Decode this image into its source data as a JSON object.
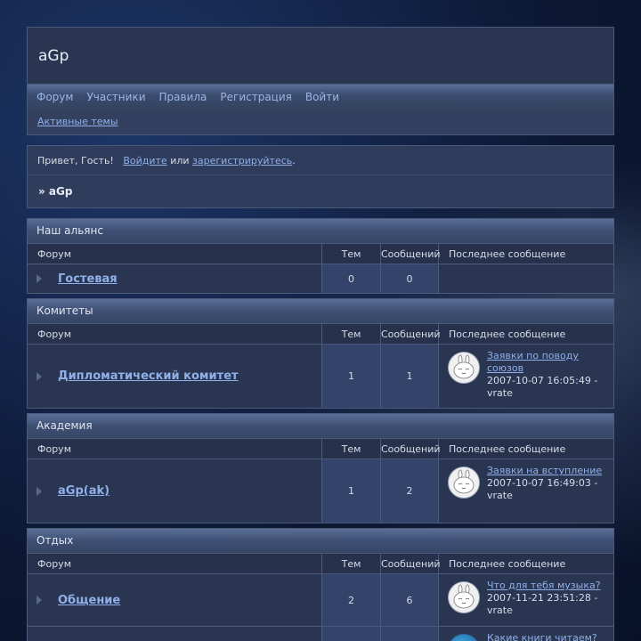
{
  "site": {
    "title": "aGp"
  },
  "nav": [
    "Форум",
    "Участники",
    "Правила",
    "Регистрация",
    "Войти"
  ],
  "subnav": {
    "active_topics": "Активные темы"
  },
  "welcome": {
    "greeting": "Привет, Гость!",
    "login": "Войдите",
    "or": "или",
    "register": "зарегистрируйтесь",
    "dot": ".",
    "breadcrumb": "» aGp"
  },
  "columns": {
    "forum": "Форум",
    "topics": "Тем",
    "posts": "Сообщений",
    "last": "Последнее сообщение"
  },
  "categories": [
    {
      "title": "Наш альянс",
      "forums": [
        {
          "name": "Гостевая",
          "topics": "0",
          "posts": "0",
          "last": null
        }
      ]
    },
    {
      "title": "Комитеты",
      "forums": [
        {
          "name": "Дипломатический комитет",
          "topics": "1",
          "posts": "1",
          "last": {
            "topic": "Заявки по поводу союзов",
            "date": "2007-10-07 16:05:49 -",
            "user": "vrate",
            "avatar": "rabbit-avatar-icon"
          }
        }
      ]
    },
    {
      "title": "Академия",
      "forums": [
        {
          "name": "aGp(ak)",
          "topics": "1",
          "posts": "2",
          "last": {
            "topic": "Заявки на вступление",
            "date": "2007-10-07 16:49:03 -",
            "user": "vrate",
            "avatar": "rabbit-avatar-icon"
          }
        }
      ]
    },
    {
      "title": "Отдых",
      "forums": [
        {
          "name": "Общение",
          "topics": "2",
          "posts": "6",
          "last": {
            "topic": "Что для тебя музыка?",
            "date": "2007-11-21 23:51:28 -",
            "user": "vrate",
            "avatar": "rabbit-avatar-icon"
          }
        },
        {
          "name": "",
          "topics": "",
          "posts": "",
          "last": {
            "topic": "Какие книги читаем?",
            "date": "",
            "user": "",
            "avatar": "globe-avatar-icon"
          }
        }
      ]
    }
  ]
}
